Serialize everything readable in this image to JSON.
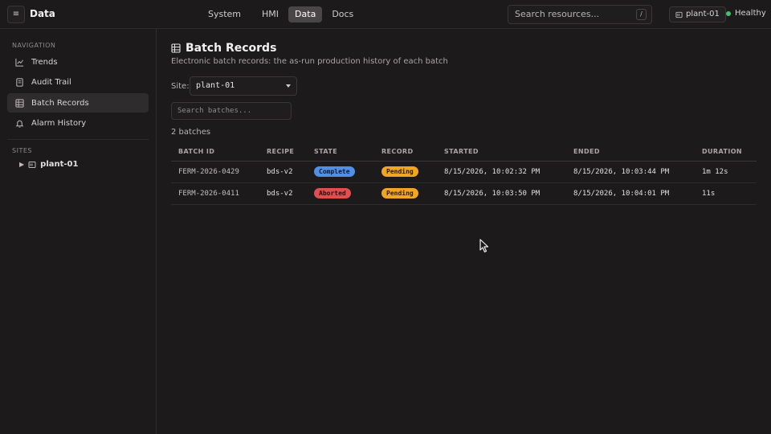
{
  "header": {
    "menu_icon": "hamburger-icon",
    "menu_glyph": "≡",
    "app_title": "Data",
    "nav": [
      "System",
      "HMI",
      "Data",
      "Docs"
    ],
    "nav_active": "Data",
    "search_placeholder": "Search resources...",
    "search_shortcut": "/",
    "site_chip": "plant-01",
    "status": "Healthy",
    "status_color": "#3ec46d"
  },
  "sidebar": {
    "navigation_label": "NAVIGATION",
    "items": [
      {
        "label": "Trends",
        "icon": "line-chart-icon",
        "active": false
      },
      {
        "label": "Audit Trail",
        "icon": "document-icon",
        "active": false
      },
      {
        "label": "Batch Records",
        "icon": "grid-icon",
        "active": true
      },
      {
        "label": "Alarm History",
        "icon": "bell-icon",
        "active": false
      }
    ],
    "sites_label": "SITES",
    "sites": [
      {
        "label": "plant-01",
        "icon": "server-icon"
      }
    ]
  },
  "main": {
    "title": "Batch Records",
    "title_icon": "grid-icon",
    "subtitle": "Electronic batch records: the as-run production history of each batch",
    "site_label": "Site:",
    "site_value": "plant-01",
    "search_placeholder": "Search batches...",
    "count": "2 batches",
    "columns": [
      "BATCH ID",
      "RECIPE",
      "STATE",
      "RECORD",
      "STARTED",
      "ENDED",
      "DURATION"
    ],
    "rows": [
      {
        "batch_id": "FERM-2026-0429",
        "recipe": "bds-v2",
        "state": "Complete",
        "state_color": "#4f8fe6",
        "record": "Pending",
        "record_color": "#f0a623",
        "started": "8/15/2026, 10:02:32 PM",
        "ended": "8/15/2026, 10:03:44 PM",
        "duration": "1m 12s"
      },
      {
        "batch_id": "FERM-2026-0411",
        "recipe": "bds-v2",
        "state": "Aborted",
        "state_color": "#e04e4e",
        "record": "Pending",
        "record_color": "#f0a623",
        "started": "8/15/2026, 10:03:50 PM",
        "ended": "8/15/2026, 10:04:01 PM",
        "duration": "11s"
      }
    ]
  }
}
